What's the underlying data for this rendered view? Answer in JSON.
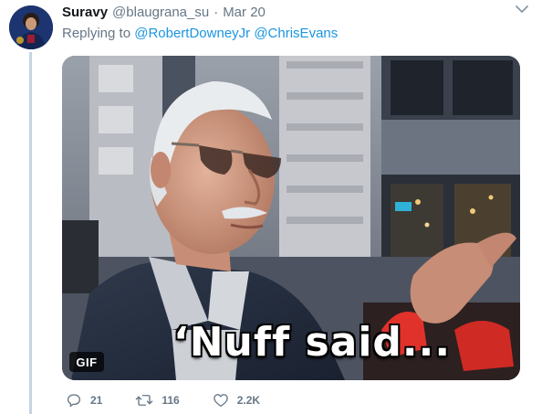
{
  "tweet": {
    "author_name": "Suravy",
    "author_handle": "@blaugrana_su",
    "separator": "·",
    "date": "Mar 20",
    "replying_to_label": "Replying to",
    "mentions": [
      "@RobertDowneyJr",
      "@ChrisEvans"
    ],
    "media": {
      "caption": "‘Nuff said...",
      "badge": "GIF"
    },
    "actions": {
      "replies": "21",
      "retweets": "116",
      "likes": "2.2K"
    }
  },
  "icons": {
    "caret": "chevron-down-icon",
    "reply": "comment-icon",
    "retweet": "retweet-icon",
    "like": "heart-icon"
  },
  "colors": {
    "link": "#1b95e0",
    "muted": "#657786",
    "thread_line": "#c4d5e3"
  }
}
